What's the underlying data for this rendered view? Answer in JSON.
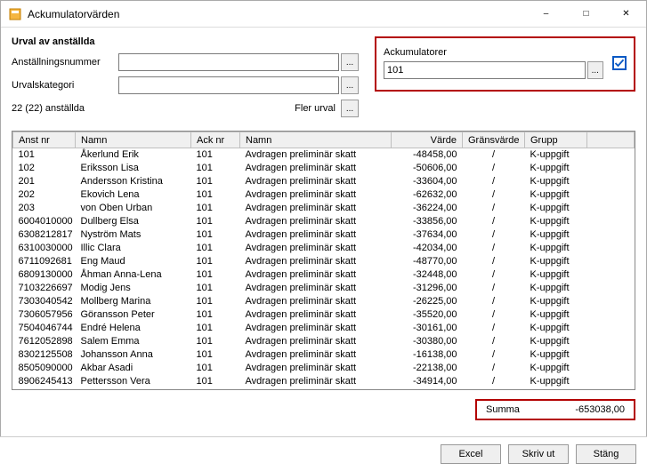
{
  "window": {
    "title": "Ackumulatorvärden"
  },
  "urval": {
    "heading": "Urval av anställda",
    "anstallningsnummer_label": "Anställningsnummer",
    "anstallningsnummer_value": "",
    "urvalskategori_label": "Urvalskategori",
    "urvalskategori_value": "",
    "count_text": "22 (22) anställda",
    "fler_urval_label": "Fler urval"
  },
  "ack": {
    "label": "Ackumulatorer",
    "value": "101",
    "checked": true
  },
  "table": {
    "headers": {
      "anst_nr": "Anst nr",
      "namn": "Namn",
      "ack_nr": "Ack nr",
      "namn2": "Namn",
      "varde": "Värde",
      "gransvarde": "Gränsvärde",
      "grupp": "Grupp"
    },
    "rows": [
      {
        "anst": "101",
        "namn": "Åkerlund Erik",
        "ack": "101",
        "namn2": "Avdragen preliminär skatt",
        "varde": "-48458,00",
        "grans": "/",
        "grupp": "K-uppgift"
      },
      {
        "anst": "102",
        "namn": "Eriksson Lisa",
        "ack": "101",
        "namn2": "Avdragen preliminär skatt",
        "varde": "-50606,00",
        "grans": "/",
        "grupp": "K-uppgift"
      },
      {
        "anst": "201",
        "namn": "Andersson Kristina",
        "ack": "101",
        "namn2": "Avdragen preliminär skatt",
        "varde": "-33604,00",
        "grans": "/",
        "grupp": "K-uppgift"
      },
      {
        "anst": "202",
        "namn": "Ekovich Lena",
        "ack": "101",
        "namn2": "Avdragen preliminär skatt",
        "varde": "-62632,00",
        "grans": "/",
        "grupp": "K-uppgift"
      },
      {
        "anst": "203",
        "namn": "von Oben Urban",
        "ack": "101",
        "namn2": "Avdragen preliminär skatt",
        "varde": "-36224,00",
        "grans": "/",
        "grupp": "K-uppgift"
      },
      {
        "anst": "6004010000",
        "namn": "Dullberg Elsa",
        "ack": "101",
        "namn2": "Avdragen preliminär skatt",
        "varde": "-33856,00",
        "grans": "/",
        "grupp": "K-uppgift"
      },
      {
        "anst": "6308212817",
        "namn": "Nyström Mats",
        "ack": "101",
        "namn2": "Avdragen preliminär skatt",
        "varde": "-37634,00",
        "grans": "/",
        "grupp": "K-uppgift"
      },
      {
        "anst": "6310030000",
        "namn": "Illic Clara",
        "ack": "101",
        "namn2": "Avdragen preliminär skatt",
        "varde": "-42034,00",
        "grans": "/",
        "grupp": "K-uppgift"
      },
      {
        "anst": "6711092681",
        "namn": "Eng Maud",
        "ack": "101",
        "namn2": "Avdragen preliminär skatt",
        "varde": "-48770,00",
        "grans": "/",
        "grupp": "K-uppgift"
      },
      {
        "anst": "6809130000",
        "namn": "Åhman Anna-Lena",
        "ack": "101",
        "namn2": "Avdragen preliminär skatt",
        "varde": "-32448,00",
        "grans": "/",
        "grupp": "K-uppgift"
      },
      {
        "anst": "7103226697",
        "namn": "Modig Jens",
        "ack": "101",
        "namn2": "Avdragen preliminär skatt",
        "varde": "-31296,00",
        "grans": "/",
        "grupp": "K-uppgift"
      },
      {
        "anst": "7303040542",
        "namn": "Mollberg Marina",
        "ack": "101",
        "namn2": "Avdragen preliminär skatt",
        "varde": "-26225,00",
        "grans": "/",
        "grupp": "K-uppgift"
      },
      {
        "anst": "7306057956",
        "namn": "Göransson Peter",
        "ack": "101",
        "namn2": "Avdragen preliminär skatt",
        "varde": "-35520,00",
        "grans": "/",
        "grupp": "K-uppgift"
      },
      {
        "anst": "7504046744",
        "namn": "Endré Helena",
        "ack": "101",
        "namn2": "Avdragen preliminär skatt",
        "varde": "-30161,00",
        "grans": "/",
        "grupp": "K-uppgift"
      },
      {
        "anst": "7612052898",
        "namn": "Salem Emma",
        "ack": "101",
        "namn2": "Avdragen preliminär skatt",
        "varde": "-30380,00",
        "grans": "/",
        "grupp": "K-uppgift"
      },
      {
        "anst": "8302125508",
        "namn": "Johansson Anna",
        "ack": "101",
        "namn2": "Avdragen preliminär skatt",
        "varde": "-16138,00",
        "grans": "/",
        "grupp": "K-uppgift"
      },
      {
        "anst": "8505090000",
        "namn": "Akbar Asadi",
        "ack": "101",
        "namn2": "Avdragen preliminär skatt",
        "varde": "-22138,00",
        "grans": "/",
        "grupp": "K-uppgift"
      },
      {
        "anst": "8906245413",
        "namn": "Pettersson Vera",
        "ack": "101",
        "namn2": "Avdragen preliminär skatt",
        "varde": "-34914,00",
        "grans": "/",
        "grupp": "K-uppgift"
      }
    ]
  },
  "summary": {
    "label": "Summa",
    "value": "-653038,00"
  },
  "buttons": {
    "excel": "Excel",
    "print": "Skriv ut",
    "close": "Stäng"
  }
}
